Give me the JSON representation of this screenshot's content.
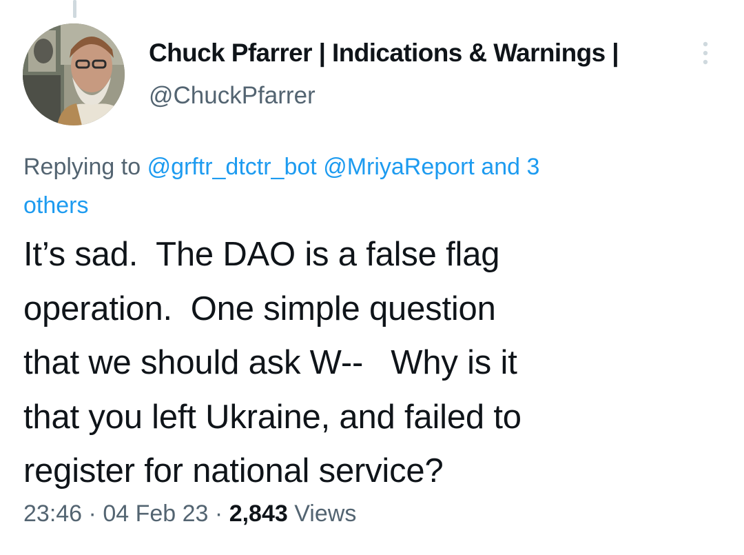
{
  "author": {
    "display_name": "Chuck Pfarrer | Indications & Warnings |",
    "handle": "@ChuckPfarrer"
  },
  "reply": {
    "prefix": "Replying to",
    "mentions": [
      "@grftr_dtctr_bot",
      "@MriyaReport"
    ],
    "and_others": "and 3",
    "others_word": "others"
  },
  "body": {
    "lines": [
      "It’s sad.  The DAO is a false flag",
      "operation.  One simple question",
      "that we should ask W--   Why is it",
      "that you left Ukraine, and failed to",
      "register for national service?"
    ]
  },
  "meta": {
    "time": "23:46",
    "separator": "·",
    "date": "04 Feb 23",
    "views_count": "2,843",
    "views_label": "Views"
  },
  "icons": {
    "more": "more-vertical-icon"
  },
  "colors": {
    "text_primary": "#0f1419",
    "text_secondary": "#536471",
    "link": "#1d9bf0",
    "thread_line": "#cfd9de"
  }
}
